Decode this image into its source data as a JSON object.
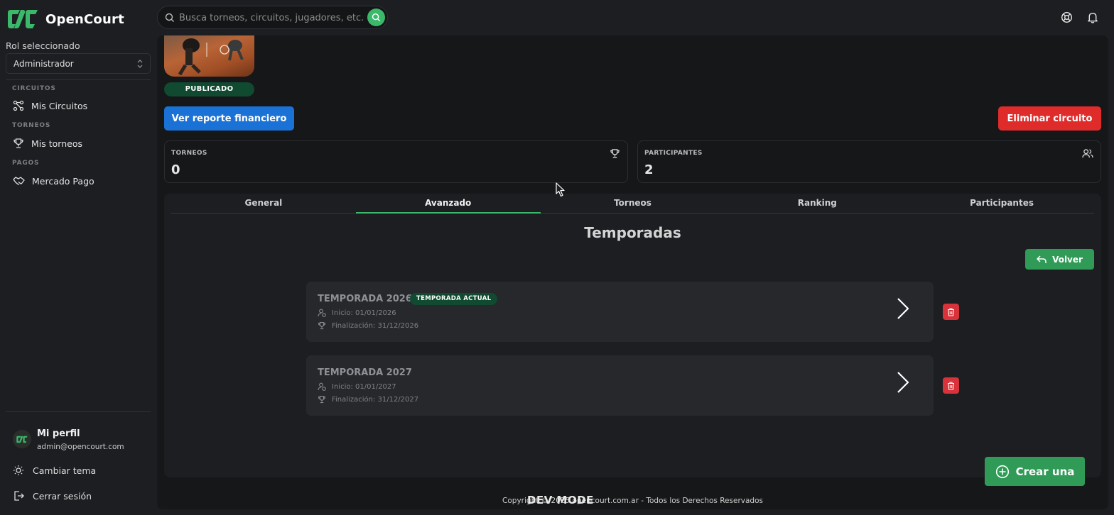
{
  "app": {
    "brand_name": "OpenCourt",
    "search_placeholder": "Busca torneos, circuitos, jugadores, etc."
  },
  "sidebar": {
    "role_label": "Rol seleccionado",
    "role_value": "Administrador",
    "sections": [
      {
        "title": "CIRCUITOS",
        "item": "Mis Circuitos"
      },
      {
        "title": "TORNEOS",
        "item": "Mis torneos"
      },
      {
        "title": "PAGOS",
        "item": "Mercado Pago"
      }
    ],
    "profile": {
      "name": "Mi perfil",
      "email": "admin@opencourt.com"
    },
    "theme_label": "Cambiar tema",
    "logout_label": "Cerrar sesión"
  },
  "circuit": {
    "status": "PUBLICADO",
    "financial_button": "Ver reporte financiero",
    "delete_button": "Eliminar circuito",
    "stats": [
      {
        "label": "TORNEOS",
        "value": "0"
      },
      {
        "label": "PARTICIPANTES",
        "value": "2"
      }
    ]
  },
  "tabs": [
    "General",
    "Avanzado",
    "Torneos",
    "Ranking",
    "Participantes"
  ],
  "active_tab": "Avanzado",
  "seasons_panel": {
    "title": "Temporadas",
    "back_button": "Volver",
    "current_badge": "TEMPORADA ACTUAL",
    "seasons": [
      {
        "name": "TEMPORADA 2026",
        "start": "Inicio: 01/01/2026",
        "end": "Finalización: 31/12/2026",
        "current": true
      },
      {
        "name": "TEMPORADA 2027",
        "start": "Inicio: 01/01/2027",
        "end": "Finalización: 31/12/2027",
        "current": false
      }
    ],
    "create_button": "Crear una"
  },
  "footer": {
    "text": "Copyright © 2025 opencourt.com.ar - Todos los Derechos Reservados",
    "dev_mode": "DEV MODE"
  },
  "colors": {
    "accent_green": "#3cb86b",
    "primary_blue": "#1a72d6",
    "danger_red": "#e02b2b",
    "badge_green": "#0f4a31"
  }
}
